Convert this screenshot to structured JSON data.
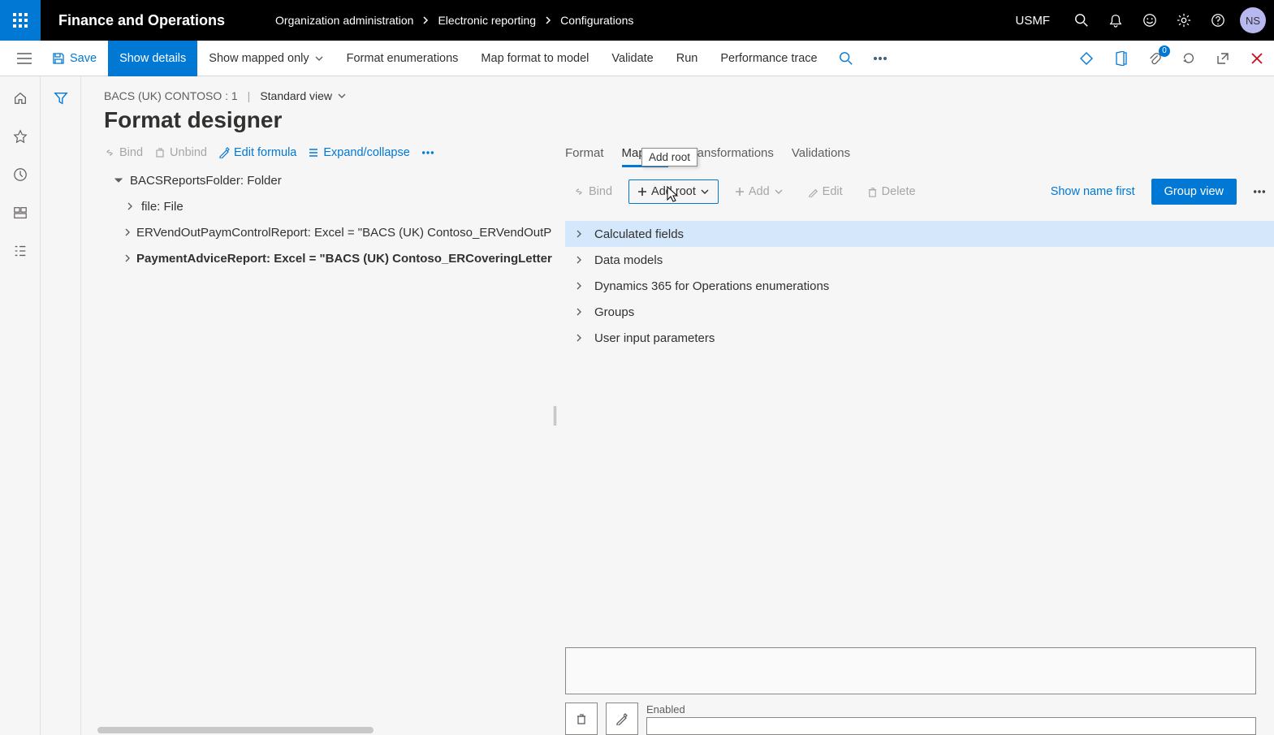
{
  "top": {
    "app_title": "Finance and Operations",
    "breadcrumbs": [
      "Organization administration",
      "Electronic reporting",
      "Configurations"
    ],
    "company": "USMF",
    "avatar": "NS"
  },
  "actionbar": {
    "save": "Save",
    "show_details": "Show details",
    "show_mapped_only": "Show mapped only",
    "format_enumerations": "Format enumerations",
    "map_format": "Map format to model",
    "validate": "Validate",
    "run": "Run",
    "perf_trace": "Performance trace",
    "attachments_count": "0"
  },
  "page": {
    "context": "BACS (UK) CONTOSO : 1",
    "view": "Standard view",
    "title": "Format designer"
  },
  "left_toolbar": {
    "bind": "Bind",
    "unbind": "Unbind",
    "edit_formula": "Edit formula",
    "expand_collapse": "Expand/collapse"
  },
  "tree": [
    {
      "label": "BACSReportsFolder: Folder",
      "level": 0,
      "expanded": true,
      "bold": false
    },
    {
      "label": "file: File",
      "level": 1,
      "expanded": false,
      "bold": false
    },
    {
      "label": "ERVendOutPaymControlReport: Excel = \"BACS (UK) Contoso_ERVendOutP",
      "level": 1,
      "expanded": false,
      "bold": false
    },
    {
      "label": "PaymentAdviceReport: Excel = \"BACS (UK) Contoso_ERCoveringLetterB",
      "level": 1,
      "expanded": false,
      "bold": true
    }
  ],
  "right_tabs": [
    "Format",
    "Mapping",
    "Transformations",
    "Validations"
  ],
  "right_tabs_active": 1,
  "right_toolbar": {
    "bind": "Bind",
    "add_root": "Add root",
    "add": "Add",
    "edit": "Edit",
    "delete": "Delete",
    "show_name_first": "Show name first",
    "group_view": "Group view",
    "tooltip": "Add root"
  },
  "data_sources": [
    "Calculated fields",
    "Data models",
    "Dynamics 365 for Operations enumerations",
    "Groups",
    "User input parameters"
  ],
  "bottom": {
    "enabled_label": "Enabled"
  }
}
